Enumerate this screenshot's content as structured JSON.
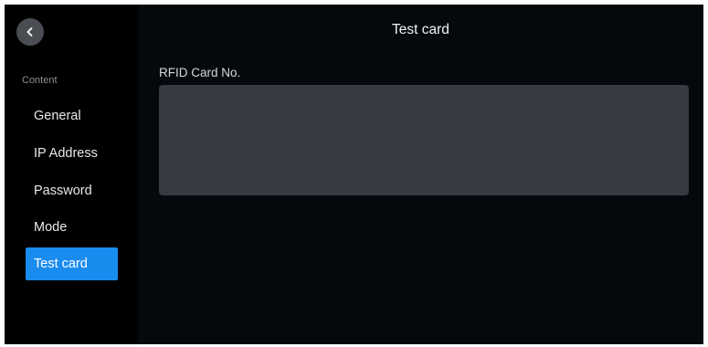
{
  "header": {
    "title": "Test card",
    "back_icon": "chevron-left-icon"
  },
  "sidebar": {
    "section_label": "Content",
    "items": [
      {
        "label": "General",
        "active": false
      },
      {
        "label": "IP Address",
        "active": false
      },
      {
        "label": "Password",
        "active": false
      },
      {
        "label": "Mode",
        "active": false
      },
      {
        "label": "Test card",
        "active": true
      }
    ]
  },
  "main": {
    "field_label": "RFID Card No.",
    "card_value": ""
  },
  "colors": {
    "accent": "#1a8cf0",
    "background": "#05080d",
    "sidebar": "#000000",
    "field": "#373b41"
  }
}
